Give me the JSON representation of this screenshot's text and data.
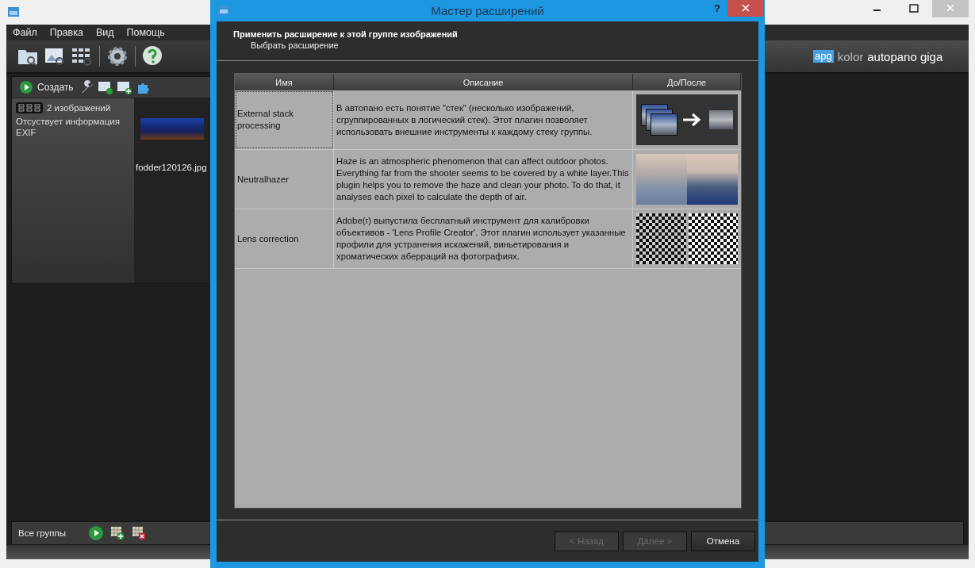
{
  "main_window": {
    "menu": [
      "Файл",
      "Правка",
      "Вид",
      "Помощь"
    ],
    "brand": {
      "logo": "apg",
      "primary": "kolor",
      "secondary": "autopano giga"
    },
    "group_toolbar": {
      "create_label": "Создать"
    },
    "group": {
      "count": "2 изображений",
      "info": "Отсуствует информация EXIF",
      "filename": "fodder120126.jpg"
    },
    "status_bar": {
      "label": "Все группы"
    }
  },
  "dialog": {
    "title": "Мастер расширений",
    "help": "?",
    "heading": "Применить расширение к этой группе изображений",
    "subheading": "Выбрать расширение",
    "table": {
      "columns": [
        "Имя",
        "Описание",
        "До/После"
      ],
      "rows": [
        {
          "name": "External stack processing",
          "description": "В автопано есть понятие \"стек\" (несколько изображений, сгруппированных в логический стек). Этот плагин позволяет использовать внешние инструменты к каждому стеку группы.",
          "kind": "stack",
          "selected": true
        },
        {
          "name": "Neutralhazer",
          "description": "Haze is an atmospheric phenomenon that can affect outdoor photos. Everything far from the shooter seems to be covered by a white layer.This plugin helps you to remove the haze and clean your photo. To do that, it analyses each pixel to calculate the depth of air.",
          "kind": "haze",
          "selected": false
        },
        {
          "name": "Lens correction",
          "description": "Adobe(r) выпустила бесплатный инструмент для калибровки объективов - 'Lens Profile Creator'. Этот плагин использует указанные профили для устранения искажений, виньетирования и хроматических аберраций на фотографиях.",
          "kind": "lens",
          "selected": false
        }
      ]
    },
    "buttons": [
      {
        "label": "< Назад",
        "disabled": true
      },
      {
        "label": "Далее >",
        "disabled": true
      },
      {
        "label": "Отмена",
        "disabled": false
      }
    ]
  }
}
